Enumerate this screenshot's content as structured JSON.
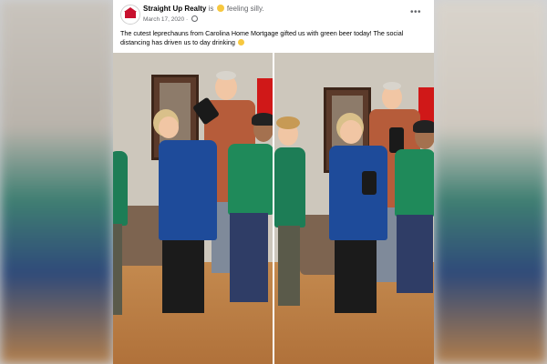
{
  "post": {
    "page_name": "Straight Up Realty",
    "is_text": "is",
    "feeling": "feeling silly.",
    "date": "March 17, 2020",
    "separator": "·",
    "more_label": "•••",
    "text": "The cutest leprechauns from Carolina Home Mortgage gifted us with green beer today!  The social distancing has driven us to day drinking"
  },
  "icons": {
    "avatar": "straight-up-realty-logo",
    "feeling": "silly-face-emoji",
    "privacy": "globe-icon",
    "more": "more-horizontal-icon",
    "text_emoji": "smiling-face-emoji"
  },
  "colors": {
    "name_text": "#050505",
    "muted_text": "#65676b",
    "logo_red": "#c8102e",
    "emoji_yellow": "#f7c83f"
  }
}
